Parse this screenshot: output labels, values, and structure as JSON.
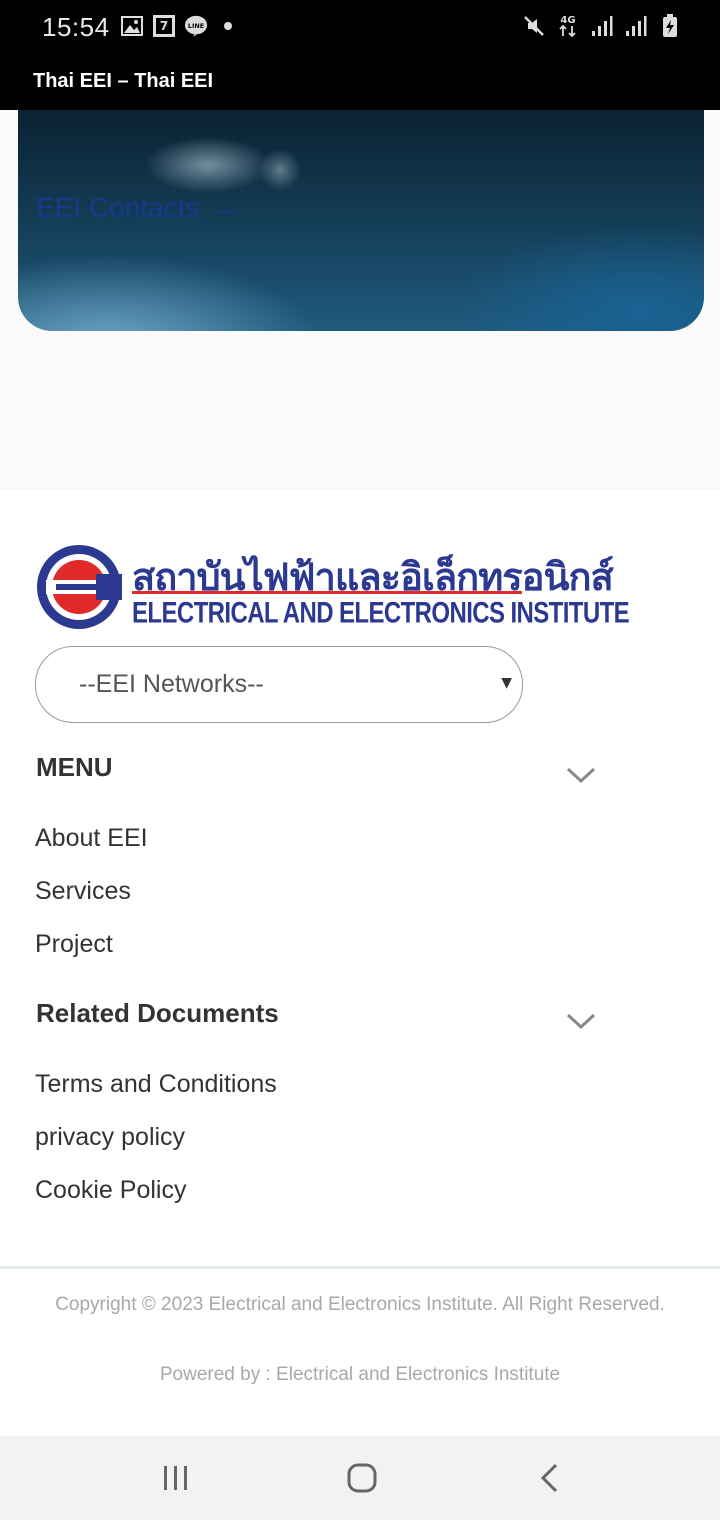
{
  "status_bar": {
    "time": "15:54",
    "icons_left": [
      "gallery-icon",
      "seven-eleven-icon",
      "line-icon",
      "dot-icon"
    ],
    "icons_right": [
      "mute-icon",
      "4g-icon",
      "signal-icon",
      "signal-icon",
      "battery-charging-icon"
    ],
    "network_label": "4G"
  },
  "app_bar": {
    "title": "Thai EEI – Thai EEI"
  },
  "hero": {
    "link_label": "EEI Contacts",
    "arrow": "→"
  },
  "footer": {
    "logo": {
      "thai_name": "สถาบันไฟฟ้าและอิเล็กทรอนิกส์",
      "english_name": "ELECTRICAL AND ELECTRONICS INSTITUTE",
      "colors": {
        "blue": "#2b3990",
        "red": "#e02a2a"
      }
    },
    "networks_select": {
      "value": "--EEI Networks--"
    },
    "menu": {
      "heading": "MENU",
      "items": [
        "About EEI",
        "Services",
        "Project"
      ]
    },
    "related_documents": {
      "heading": "Related Documents",
      "items": [
        "Terms and Conditions",
        "privacy policy",
        "Cookie Policy"
      ]
    },
    "copyright": "Copyright © 2023 Electrical and Electronics Institute. All Right Reserved.",
    "powered_by": "Powered by : Electrical and Electronics Institute"
  },
  "nav_bar": {
    "buttons": [
      "recents-icon",
      "home-icon",
      "back-icon"
    ]
  }
}
